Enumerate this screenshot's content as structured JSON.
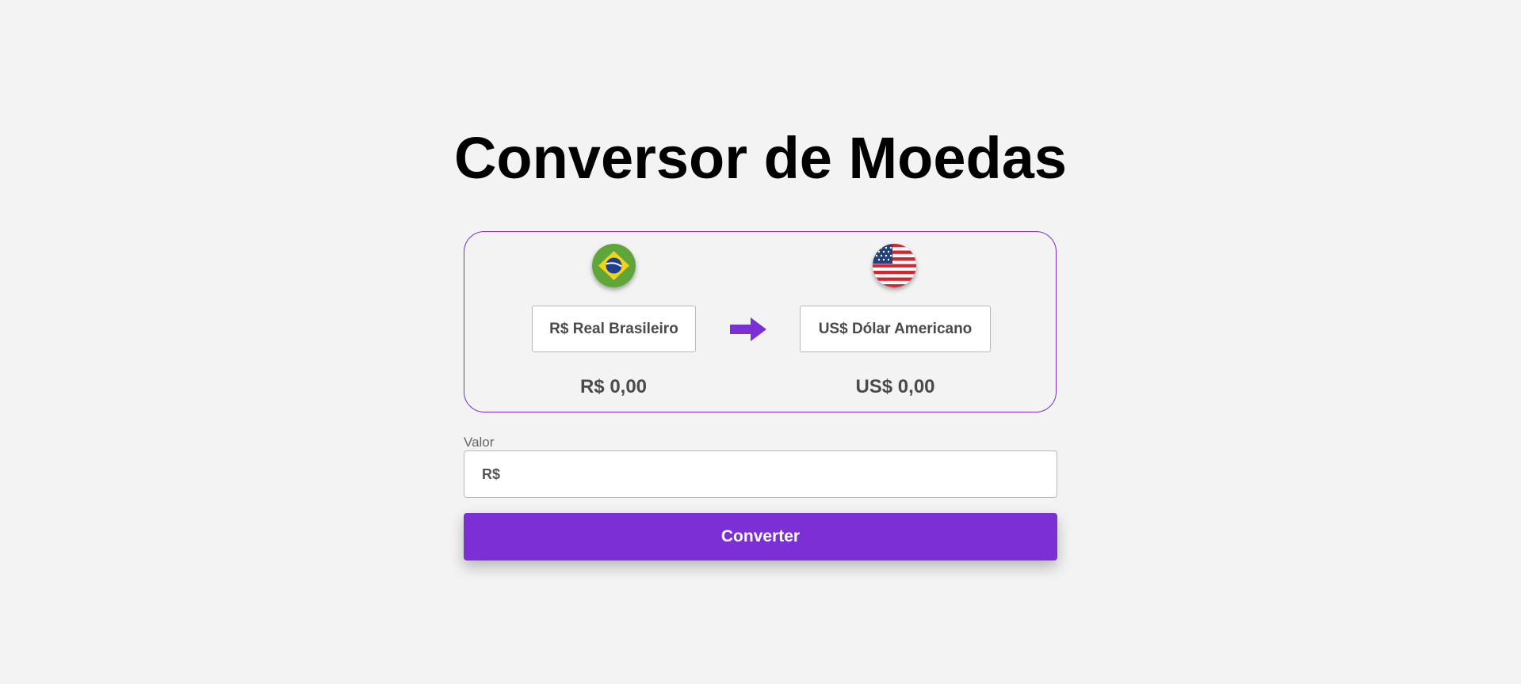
{
  "header": {
    "title": "Conversor de Moedas"
  },
  "converter": {
    "from": {
      "flag_icon": "brazil-flag-icon",
      "currency_label": "R$ Real Brasileiro",
      "amount": "R$ 0,00"
    },
    "to": {
      "flag_icon": "usa-flag-icon",
      "currency_label": "US$ Dólar Americano",
      "amount": "US$ 0,00"
    },
    "arrow_icon": "arrow-right-icon"
  },
  "value_field": {
    "label": "Valor",
    "placeholder": "R$",
    "value": ""
  },
  "actions": {
    "convert_label": "Converter"
  },
  "colors": {
    "accent": "#7b2fd4",
    "background": "#f3f3f3",
    "text_primary": "#000000",
    "text_secondary": "#4a4a4a"
  }
}
